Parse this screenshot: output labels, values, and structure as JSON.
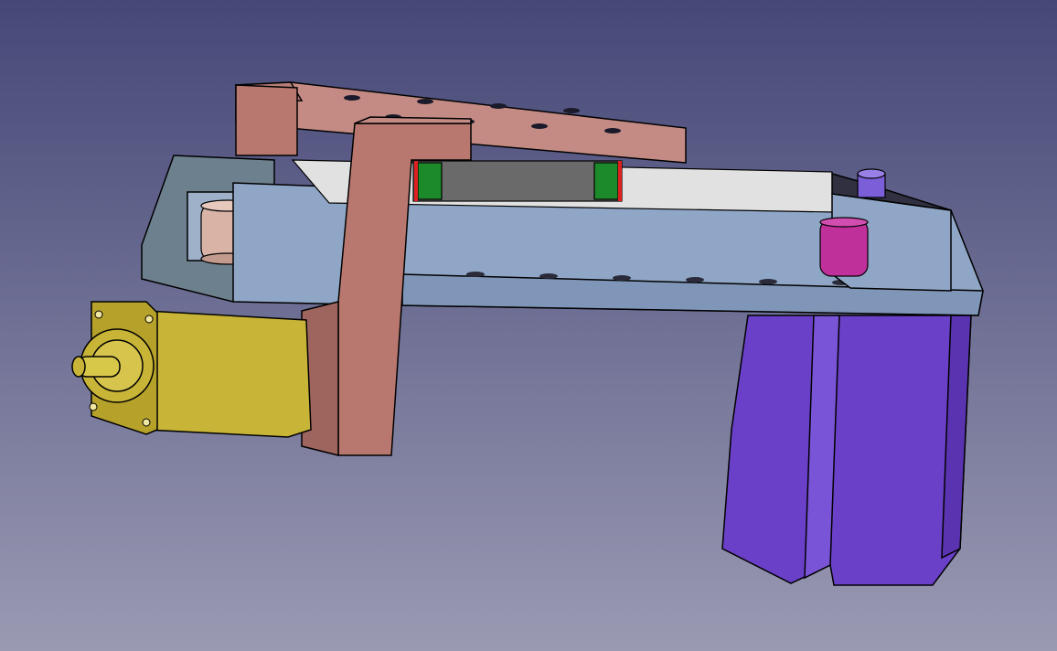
{
  "viewport": {
    "background_top": "#454777",
    "background_bottom": "#9a9ab3"
  },
  "model": {
    "parts": [
      {
        "name": "top-plate-frame",
        "color": "#c48b85"
      },
      {
        "name": "vertical-bracket",
        "color": "#b9786f"
      },
      {
        "name": "linear-rail-housing",
        "color": "#8fa6c6"
      },
      {
        "name": "rail-carriage",
        "color": "#6a6a6a"
      },
      {
        "name": "carriage-end-seal",
        "color": "#1c8a2a"
      },
      {
        "name": "end-bracket-left",
        "color": "#6d808e"
      },
      {
        "name": "idler-pulley",
        "color": "#d8b3a6"
      },
      {
        "name": "drive-pulley",
        "color": "#c0309b"
      },
      {
        "name": "stepper-motor-yellow",
        "color": "#c8b437"
      },
      {
        "name": "stepper-motor-purple",
        "color": "#6a40c8"
      },
      {
        "name": "coupler-post",
        "color": "#7a5fd8"
      }
    ]
  }
}
